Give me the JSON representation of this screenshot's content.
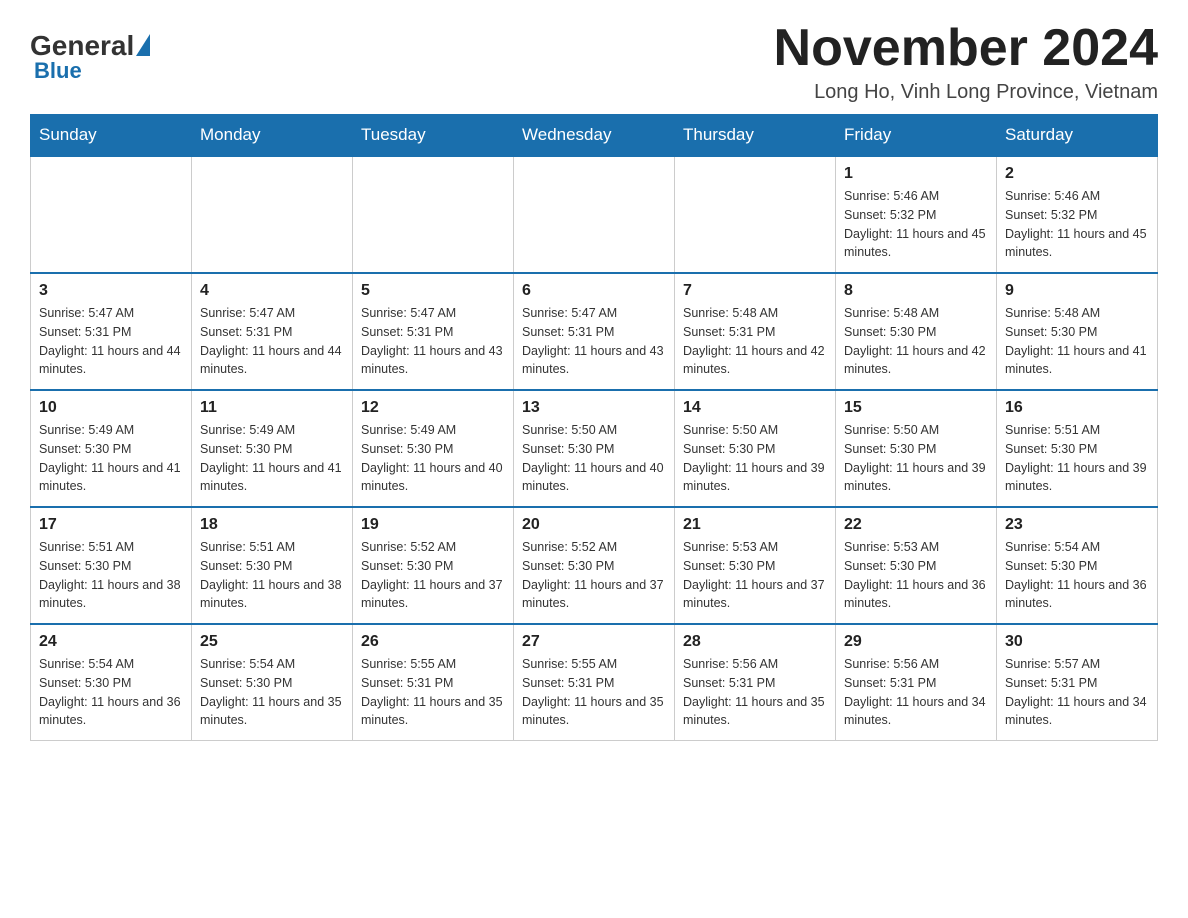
{
  "header": {
    "logo": {
      "general": "General",
      "blue": "Blue"
    },
    "title": "November 2024",
    "location": "Long Ho, Vinh Long Province, Vietnam"
  },
  "calendar": {
    "weekdays": [
      "Sunday",
      "Monday",
      "Tuesday",
      "Wednesday",
      "Thursday",
      "Friday",
      "Saturday"
    ],
    "weeks": [
      [
        {
          "day": null,
          "info": null
        },
        {
          "day": null,
          "info": null
        },
        {
          "day": null,
          "info": null
        },
        {
          "day": null,
          "info": null
        },
        {
          "day": null,
          "info": null
        },
        {
          "day": "1",
          "info": "Sunrise: 5:46 AM\nSunset: 5:32 PM\nDaylight: 11 hours and 45 minutes."
        },
        {
          "day": "2",
          "info": "Sunrise: 5:46 AM\nSunset: 5:32 PM\nDaylight: 11 hours and 45 minutes."
        }
      ],
      [
        {
          "day": "3",
          "info": "Sunrise: 5:47 AM\nSunset: 5:31 PM\nDaylight: 11 hours and 44 minutes."
        },
        {
          "day": "4",
          "info": "Sunrise: 5:47 AM\nSunset: 5:31 PM\nDaylight: 11 hours and 44 minutes."
        },
        {
          "day": "5",
          "info": "Sunrise: 5:47 AM\nSunset: 5:31 PM\nDaylight: 11 hours and 43 minutes."
        },
        {
          "day": "6",
          "info": "Sunrise: 5:47 AM\nSunset: 5:31 PM\nDaylight: 11 hours and 43 minutes."
        },
        {
          "day": "7",
          "info": "Sunrise: 5:48 AM\nSunset: 5:31 PM\nDaylight: 11 hours and 42 minutes."
        },
        {
          "day": "8",
          "info": "Sunrise: 5:48 AM\nSunset: 5:30 PM\nDaylight: 11 hours and 42 minutes."
        },
        {
          "day": "9",
          "info": "Sunrise: 5:48 AM\nSunset: 5:30 PM\nDaylight: 11 hours and 41 minutes."
        }
      ],
      [
        {
          "day": "10",
          "info": "Sunrise: 5:49 AM\nSunset: 5:30 PM\nDaylight: 11 hours and 41 minutes."
        },
        {
          "day": "11",
          "info": "Sunrise: 5:49 AM\nSunset: 5:30 PM\nDaylight: 11 hours and 41 minutes."
        },
        {
          "day": "12",
          "info": "Sunrise: 5:49 AM\nSunset: 5:30 PM\nDaylight: 11 hours and 40 minutes."
        },
        {
          "day": "13",
          "info": "Sunrise: 5:50 AM\nSunset: 5:30 PM\nDaylight: 11 hours and 40 minutes."
        },
        {
          "day": "14",
          "info": "Sunrise: 5:50 AM\nSunset: 5:30 PM\nDaylight: 11 hours and 39 minutes."
        },
        {
          "day": "15",
          "info": "Sunrise: 5:50 AM\nSunset: 5:30 PM\nDaylight: 11 hours and 39 minutes."
        },
        {
          "day": "16",
          "info": "Sunrise: 5:51 AM\nSunset: 5:30 PM\nDaylight: 11 hours and 39 minutes."
        }
      ],
      [
        {
          "day": "17",
          "info": "Sunrise: 5:51 AM\nSunset: 5:30 PM\nDaylight: 11 hours and 38 minutes."
        },
        {
          "day": "18",
          "info": "Sunrise: 5:51 AM\nSunset: 5:30 PM\nDaylight: 11 hours and 38 minutes."
        },
        {
          "day": "19",
          "info": "Sunrise: 5:52 AM\nSunset: 5:30 PM\nDaylight: 11 hours and 37 minutes."
        },
        {
          "day": "20",
          "info": "Sunrise: 5:52 AM\nSunset: 5:30 PM\nDaylight: 11 hours and 37 minutes."
        },
        {
          "day": "21",
          "info": "Sunrise: 5:53 AM\nSunset: 5:30 PM\nDaylight: 11 hours and 37 minutes."
        },
        {
          "day": "22",
          "info": "Sunrise: 5:53 AM\nSunset: 5:30 PM\nDaylight: 11 hours and 36 minutes."
        },
        {
          "day": "23",
          "info": "Sunrise: 5:54 AM\nSunset: 5:30 PM\nDaylight: 11 hours and 36 minutes."
        }
      ],
      [
        {
          "day": "24",
          "info": "Sunrise: 5:54 AM\nSunset: 5:30 PM\nDaylight: 11 hours and 36 minutes."
        },
        {
          "day": "25",
          "info": "Sunrise: 5:54 AM\nSunset: 5:30 PM\nDaylight: 11 hours and 35 minutes."
        },
        {
          "day": "26",
          "info": "Sunrise: 5:55 AM\nSunset: 5:31 PM\nDaylight: 11 hours and 35 minutes."
        },
        {
          "day": "27",
          "info": "Sunrise: 5:55 AM\nSunset: 5:31 PM\nDaylight: 11 hours and 35 minutes."
        },
        {
          "day": "28",
          "info": "Sunrise: 5:56 AM\nSunset: 5:31 PM\nDaylight: 11 hours and 35 minutes."
        },
        {
          "day": "29",
          "info": "Sunrise: 5:56 AM\nSunset: 5:31 PM\nDaylight: 11 hours and 34 minutes."
        },
        {
          "day": "30",
          "info": "Sunrise: 5:57 AM\nSunset: 5:31 PM\nDaylight: 11 hours and 34 minutes."
        }
      ]
    ]
  }
}
